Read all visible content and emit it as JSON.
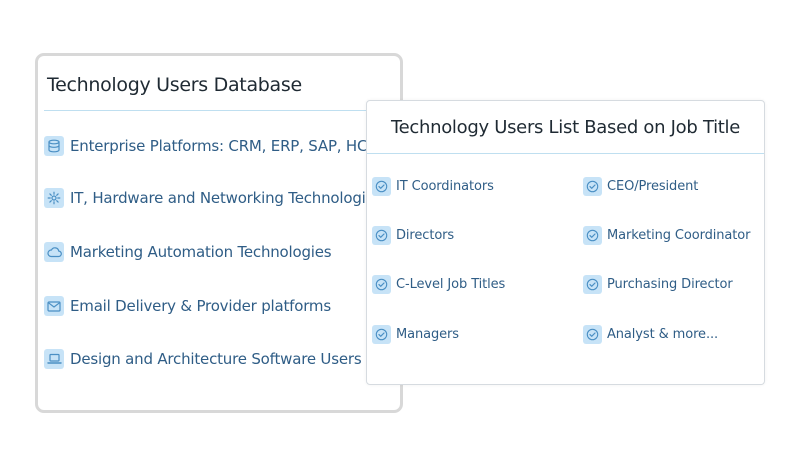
{
  "database_card": {
    "title": "Technology Users Database",
    "items": [
      {
        "label": "Enterprise Platforms: CRM, ERP, SAP, HCM",
        "icon": "database-icon"
      },
      {
        "label": "IT, Hardware and Networking Technologies",
        "icon": "gear-icon"
      },
      {
        "label": "Marketing Automation Technologies",
        "icon": "cloud-icon"
      },
      {
        "label": "Email Delivery & Provider platforms",
        "icon": "envelope-icon"
      },
      {
        "label": "Design and Architecture Software Users",
        "icon": "laptop-icon"
      }
    ]
  },
  "job_title_card": {
    "title": "Technology Users List Based on Job Title",
    "left_column": [
      {
        "label": "IT Coordinators",
        "icon": "check-circle-icon"
      },
      {
        "label": "Directors",
        "icon": "check-circle-icon"
      },
      {
        "label": "C-Level Job Titles",
        "icon": "check-circle-icon"
      },
      {
        "label": "Managers",
        "icon": "check-circle-icon"
      }
    ],
    "right_column": [
      {
        "label": "CEO/President",
        "icon": "check-circle-icon"
      },
      {
        "label": "Marketing Coordinator",
        "icon": "check-circle-icon"
      },
      {
        "label": "Purchasing Director",
        "icon": "check-circle-icon"
      },
      {
        "label": "Analyst & more...",
        "icon": "check-circle-icon"
      }
    ]
  },
  "colors": {
    "icon_background": "#c7e3f7",
    "icon_stroke": "#4a8fc4",
    "link_text": "#2f5d86",
    "title_text": "#1f2a33",
    "divider": "#bfdff0"
  }
}
